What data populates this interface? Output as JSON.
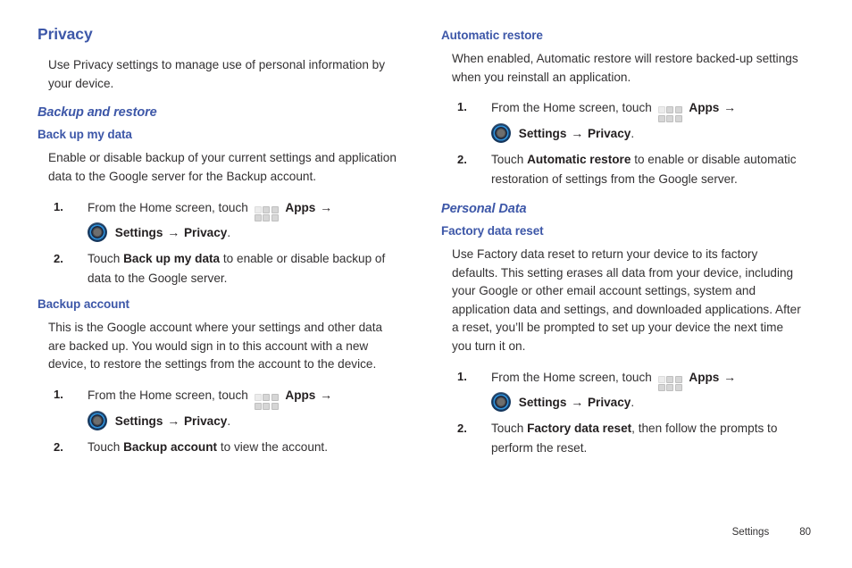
{
  "footer": {
    "section": "Settings",
    "page_number": "80"
  },
  "icons": {
    "apps": "apps-grid-icon",
    "settings": "settings-gear-icon",
    "arrow": "→"
  },
  "left_column": {
    "title": "Privacy",
    "intro": "Use Privacy settings to manage use of personal information by your device.",
    "backup_restore_heading": "Backup and restore",
    "back_up_my_data": {
      "heading": "Back up my data",
      "body": "Enable or disable backup of your current settings and application data to the Google server for the Backup account.",
      "steps": [
        {
          "num": "1.",
          "pre_icon": "From the Home screen, touch",
          "apps_label": "Apps",
          "settings_label": "Settings",
          "target_label": "Privacy",
          "period": "."
        },
        {
          "num": "2.",
          "lead": "Touch",
          "bold": "Back up my data",
          "tail": "to enable or disable backup of data to the Google server."
        }
      ]
    },
    "backup_account": {
      "heading": "Backup account",
      "body": "This is the Google account where your settings and other data are backed up. You would sign in to this account with a new device, to restore the settings from the account to the device.",
      "steps": [
        {
          "num": "1.",
          "pre_icon": "From the Home screen, touch",
          "apps_label": "Apps",
          "settings_label": "Settings",
          "target_label": "Privacy",
          "period": "."
        },
        {
          "num": "2.",
          "lead": "Touch",
          "bold": "Backup account",
          "tail": "to view the account."
        }
      ]
    }
  },
  "right_column": {
    "automatic_restore": {
      "heading": "Automatic restore",
      "body": "When enabled, Automatic restore will restore backed-up settings when you reinstall an application.",
      "steps": [
        {
          "num": "1.",
          "pre_icon": "From the Home screen, touch",
          "apps_label": "Apps",
          "settings_label": "Settings",
          "target_label": "Privacy",
          "period": "."
        },
        {
          "num": "2.",
          "lead": "Touch",
          "bold": "Automatic restore",
          "tail": "to enable or disable automatic restoration of settings from the Google server."
        }
      ]
    },
    "personal_data_heading": "Personal Data",
    "factory_data_reset": {
      "heading": "Factory data reset",
      "body": "Use Factory data reset to return your device to its factory defaults. This setting erases all data from your device, including your Google or other email account settings, system and application data and settings, and downloaded applications. After a reset, you’ll be prompted to set up your device the next time you turn it on.",
      "steps": [
        {
          "num": "1.",
          "pre_icon": "From the Home screen, touch",
          "apps_label": "Apps",
          "settings_label": "Settings",
          "target_label": "Privacy",
          "period": "."
        },
        {
          "num": "2.",
          "lead": "Touch",
          "bold": "Factory data reset",
          "tail": ", then follow the prompts to perform the reset."
        }
      ]
    }
  }
}
